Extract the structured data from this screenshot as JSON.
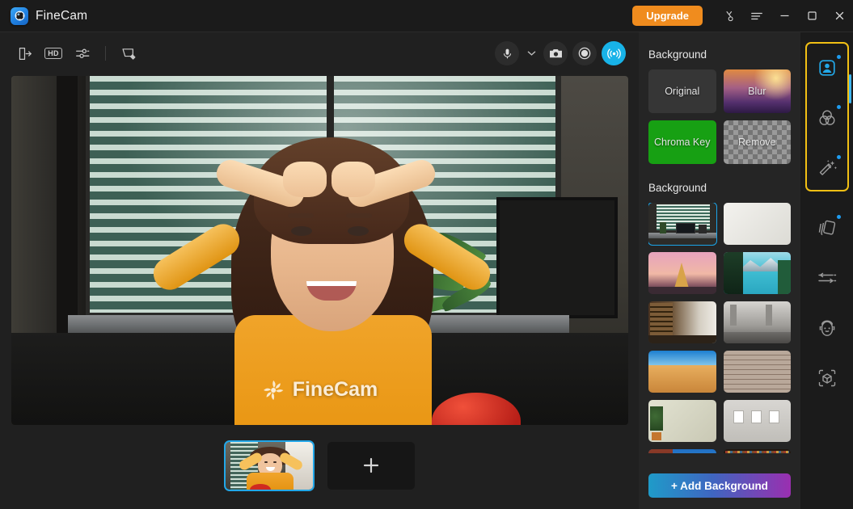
{
  "window": {
    "app_title": "FineCam",
    "logo_icon": "finecam-aperture-logo",
    "upgrade_label": "Upgrade",
    "controls": {
      "pin_icon": "pin-cursor-icon",
      "menu_icon": "hamburger-menu-icon",
      "minimize_icon": "minimize-icon",
      "maximize_icon": "maximize-icon",
      "close_icon": "close-icon"
    },
    "accent_orange": "#f08c1e",
    "accent_cyan": "#18b3e8",
    "highlight_yellow": "#f2c014",
    "panel_bg": "#252525",
    "window_bg": "#1b1b1b"
  },
  "toolbar": {
    "left": [
      {
        "name": "virtual-camera-output-icon",
        "label": "Virtual Camera Output"
      },
      {
        "name": "hd-quality-icon",
        "label": "HD"
      },
      {
        "name": "camera-settings-sliders-icon",
        "label": "Camera Settings"
      },
      {
        "name": "whiteboard-annotation-icon",
        "label": "Whiteboard"
      }
    ],
    "right": [
      {
        "name": "microphone-icon",
        "label": "Microphone"
      },
      {
        "name": "chevron-down-icon",
        "label": "Audio device list"
      },
      {
        "name": "snapshot-camera-icon",
        "label": "Snapshot"
      },
      {
        "name": "record-icon",
        "label": "Record"
      },
      {
        "name": "broadcast-icon",
        "label": "Broadcast",
        "active": true
      }
    ]
  },
  "preview": {
    "watermark_text": "FineCam",
    "watermark_icon": "finecam-aperture-logo"
  },
  "source_strip": {
    "sources": [
      {
        "name": "camera-source-thumbnail",
        "selected": true
      }
    ],
    "add_label": "+",
    "add_name": "add-source-button"
  },
  "right_panel": {
    "section_mode_title": "Background",
    "modes": [
      {
        "label": "Original",
        "style": "original",
        "name": "background-mode-original"
      },
      {
        "label": "Blur",
        "style": "blur",
        "name": "background-mode-blur"
      },
      {
        "label": "Chroma Key",
        "style": "chroma",
        "name": "background-mode-chroma-key"
      },
      {
        "label": "Remove",
        "style": "remove",
        "name": "background-mode-remove"
      }
    ],
    "section_library_title": "Background",
    "backgrounds": [
      {
        "name": "background-thumb-office-blinds",
        "selected": true
      },
      {
        "name": "background-thumb-white-wall",
        "selected": false
      },
      {
        "name": "background-thumb-eiffel-tower",
        "selected": false
      },
      {
        "name": "background-thumb-lake-mountains",
        "selected": false
      },
      {
        "name": "background-thumb-bookshelf-room",
        "selected": false
      },
      {
        "name": "background-thumb-loft-gym",
        "selected": false
      },
      {
        "name": "background-thumb-desert-dunes",
        "selected": false
      },
      {
        "name": "background-thumb-brick-wall",
        "selected": false
      },
      {
        "name": "background-thumb-plant-beige-wall",
        "selected": false
      },
      {
        "name": "background-thumb-gallery-wall",
        "selected": false
      },
      {
        "name": "background-thumb-red-rock-sky",
        "selected": false
      },
      {
        "name": "background-thumb-library-shelves",
        "selected": false
      }
    ],
    "add_background_label": "+ Add Background"
  },
  "right_rail": {
    "highlighted_group_count": 3,
    "items": [
      {
        "name": "rail-portrait-background-icon",
        "label": "Background",
        "active": true,
        "dot": true,
        "in_highlight": true
      },
      {
        "name": "rail-color-filter-icon",
        "label": "Filters",
        "active": false,
        "dot": true,
        "in_highlight": true
      },
      {
        "name": "rail-magic-wand-icon",
        "label": "Beauty Effects",
        "active": false,
        "dot": true,
        "in_highlight": true
      },
      {
        "name": "rail-layers-cards-icon",
        "label": "Layers",
        "active": false,
        "dot": true,
        "in_highlight": false
      },
      {
        "name": "rail-adjust-sliders-icon",
        "label": "Adjust",
        "active": false,
        "dot": false,
        "in_highlight": false
      },
      {
        "name": "rail-avatar-face-icon",
        "label": "Avatar",
        "active": false,
        "dot": false,
        "in_highlight": false
      },
      {
        "name": "rail-3d-object-icon",
        "label": "3D Object",
        "active": false,
        "dot": false,
        "in_highlight": false
      }
    ]
  }
}
